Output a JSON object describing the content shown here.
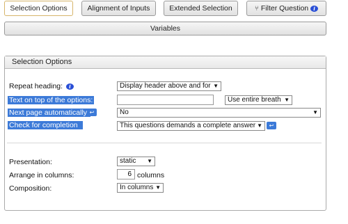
{
  "tabs": [
    {
      "label": "Selection Options"
    },
    {
      "label": "Alignment of Inputs"
    },
    {
      "label": "Extended Selection"
    },
    {
      "label": "Filter Question"
    }
  ],
  "variables_button": "Variables",
  "panel": {
    "title": "Selection Options",
    "repeat_heading": {
      "label": "Repeat heading:",
      "value": "Display header above and for"
    },
    "text_on_top": {
      "label": "Text on top of the options:",
      "value": "",
      "width_select": "Use entire breath"
    },
    "next_page": {
      "label": "Next page automatically:",
      "value": "No"
    },
    "check_completion": {
      "label": "Check for completion",
      "value": "This questions demands a complete answer"
    },
    "presentation": {
      "label": "Presentation:",
      "value": "static"
    },
    "arrange_columns": {
      "label": "Arrange in columns:",
      "value": "6",
      "unit": "columns"
    },
    "composition": {
      "label": "Composition:",
      "value": "In columns"
    }
  },
  "icons": {
    "info": "info-icon",
    "filter": "filter-icon",
    "help": "help-icon"
  },
  "colors": {
    "highlight": "#3c7ad8",
    "active_tab_border": "#d6b56a"
  }
}
